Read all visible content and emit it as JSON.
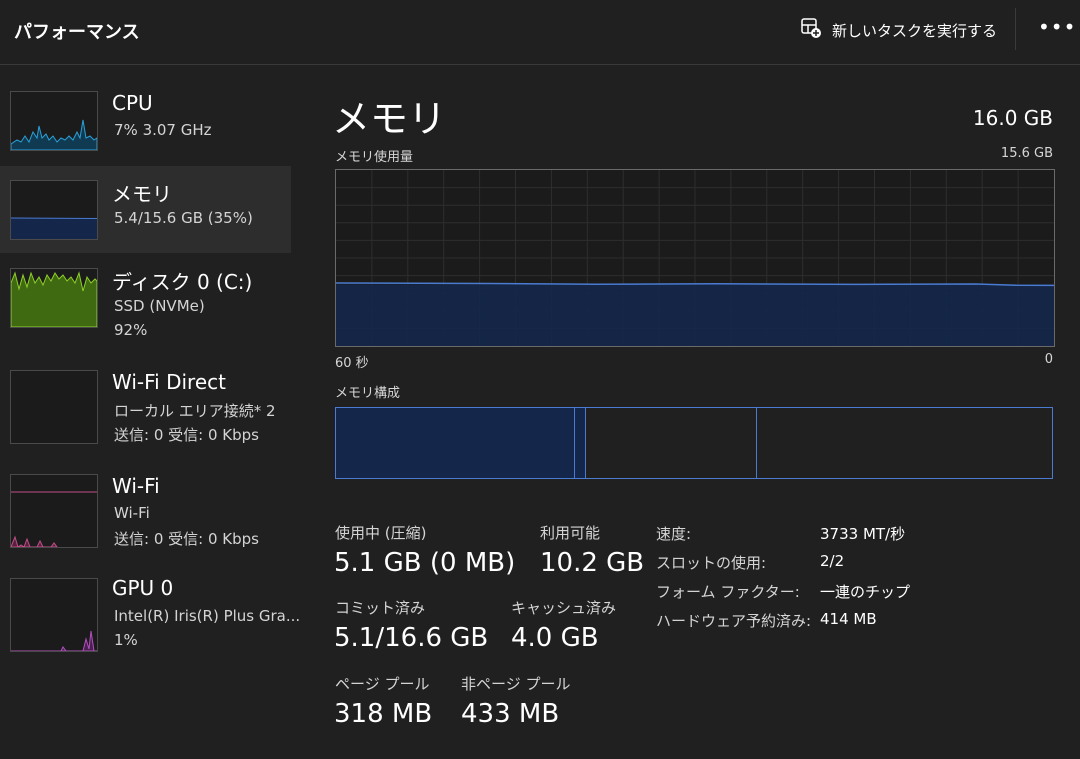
{
  "header": {
    "title": "パフォーマンス",
    "new_task_label": "新しいタスクを実行する",
    "more_label": "•••"
  },
  "sidebar": {
    "items": [
      {
        "name": "CPU",
        "sub1": "7%  3.07 GHz",
        "sub2": "",
        "color": "#2aa0d8"
      },
      {
        "name": "メモリ",
        "sub1": "5.4/15.6 GB (35%)",
        "sub2": "",
        "color": "#4a7bd0",
        "selected": true
      },
      {
        "name": "ディスク 0 (C:)",
        "sub1": "SSD (NVMe)",
        "sub2": "92%",
        "color": "#7fbf2a"
      },
      {
        "name": "Wi-Fi Direct",
        "sub1": "ローカル エリア接続* 2",
        "sub2": "送信: 0  受信: 0 Kbps",
        "color": "#c04f8a"
      },
      {
        "name": "Wi-Fi",
        "sub1": "Wi-Fi",
        "sub2": "送信: 0  受信: 0 Kbps",
        "color": "#c04f8a"
      },
      {
        "name": "GPU 0",
        "sub1": "Intel(R) Iris(R) Plus Gra...",
        "sub2": "1%",
        "color": "#b44fc0"
      }
    ]
  },
  "main": {
    "title": "メモリ",
    "total": "16.0 GB",
    "usage_label": "メモリ使用量",
    "usage_max": "15.6 GB",
    "time_left": "60 秒",
    "time_right": "0",
    "usage_fraction": 0.35,
    "composition_label": "メモリ構成",
    "stats": {
      "in_use_label": "使用中 (圧縮)",
      "in_use_value": "5.1 GB (0 MB)",
      "available_label": "利用可能",
      "available_value": "10.2 GB",
      "committed_label": "コミット済み",
      "committed_value": "5.1/16.6 GB",
      "cached_label": "キャッシュ済み",
      "cached_value": "4.0 GB",
      "paged_label": "ページ プール",
      "paged_value": "318 MB",
      "nonpaged_label": "非ページ プール",
      "nonpaged_value": "433 MB"
    },
    "details": {
      "speed_label": "速度:",
      "speed_value": "3733 MT/秒",
      "slots_label": "スロットの使用:",
      "slots_value": "2/2",
      "form_label": "フォーム ファクター:",
      "form_value": "一連のチップ",
      "reserved_label": "ハードウェア予約済み:",
      "reserved_value": "414 MB"
    }
  },
  "colors": {
    "accent": "#4a7bd0",
    "fill": "#14274a",
    "background": "#202020"
  }
}
